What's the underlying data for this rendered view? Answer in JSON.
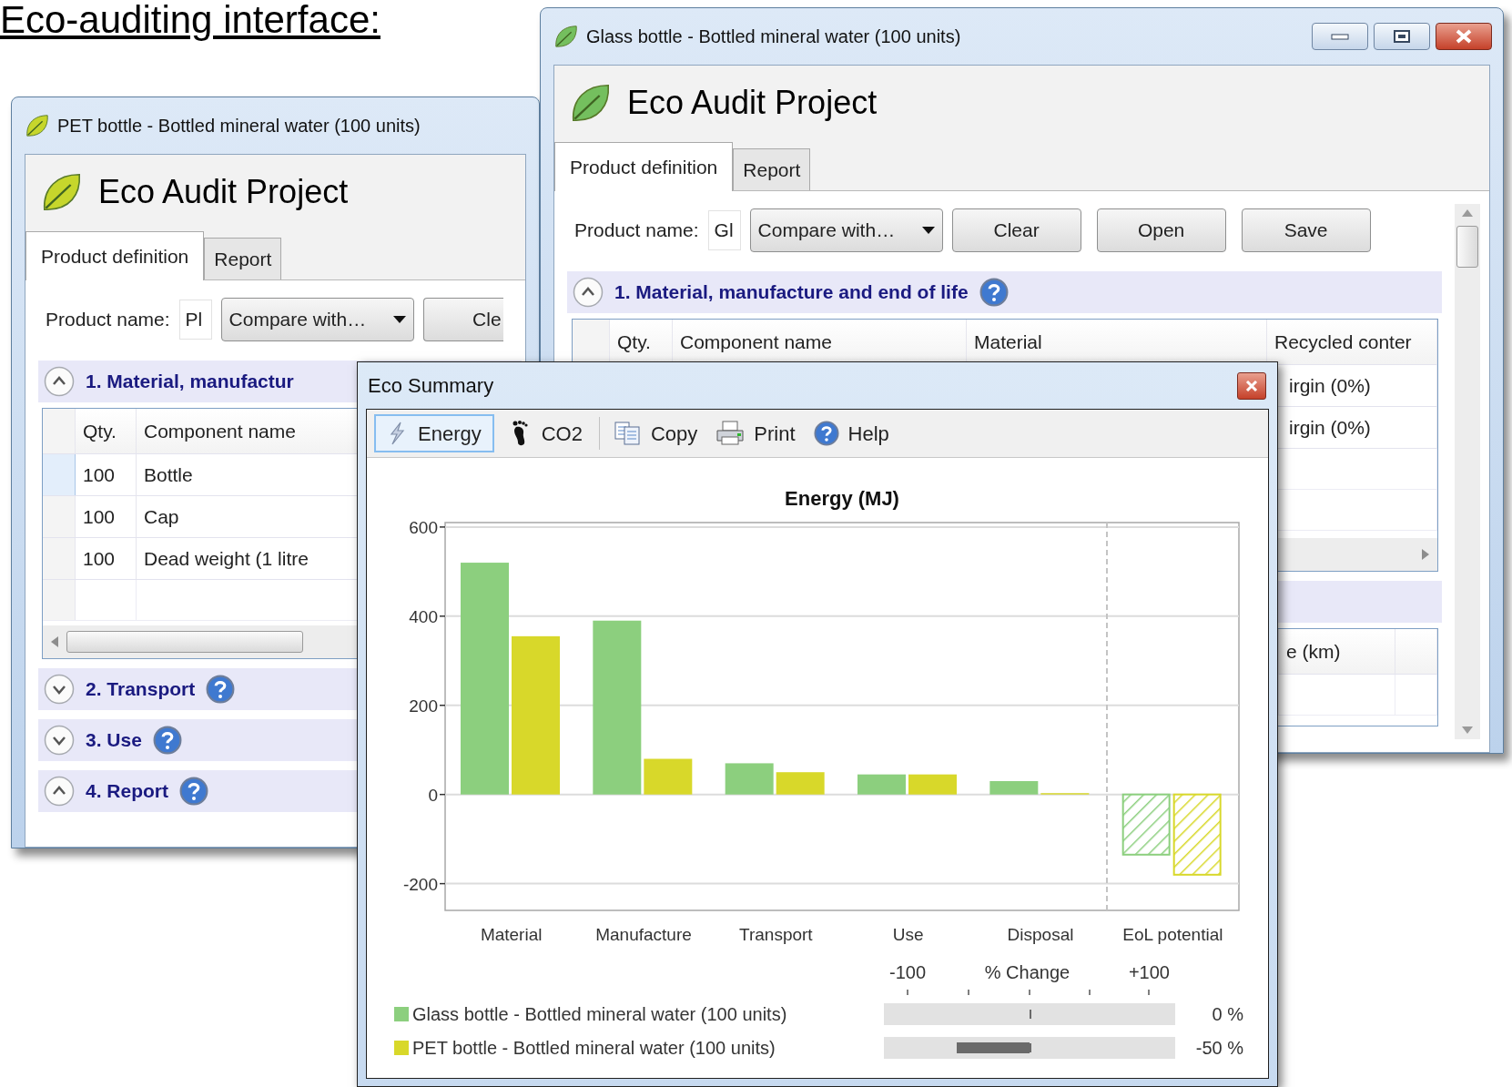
{
  "heading": "Eco-auditing interface:",
  "project_windows": [
    {
      "title": "PET bottle - Bottled mineral water (100 units)",
      "color": "#c6d62c",
      "window_controls": false,
      "app_title": "Eco Audit Project",
      "tabs": [
        {
          "label": "Product definition",
          "selected": true
        },
        {
          "label": "Report",
          "selected": false
        }
      ],
      "product_label": "Product name:",
      "product_value": "Pl",
      "compare": "Compare with…",
      "buttons": [
        "Cle"
      ],
      "sections": [
        {
          "title": "1. Material, manufactur",
          "expanded": true,
          "help": false,
          "table": {
            "columns": [
              "Qty.",
              "Component name"
            ],
            "rows": [
              {
                "cells": [
                  "100",
                  "Bottle"
                ],
                "selected": true
              },
              {
                "cells": [
                  "100",
                  "Cap"
                ],
                "selected": false
              },
              {
                "cells": [
                  "100",
                  "Dead weight (1 litre"
                ],
                "selected": false
              }
            ]
          }
        },
        {
          "title": "2. Transport",
          "expanded": false,
          "help": true
        },
        {
          "title": "3. Use",
          "expanded": false,
          "help": true
        },
        {
          "title": "4. Report",
          "expanded": true,
          "help": true
        }
      ]
    },
    {
      "title": "Glass bottle - Bottled mineral water (100 units)",
      "color": "#74bf5e",
      "window_controls": true,
      "app_title": "Eco Audit Project",
      "tabs": [
        {
          "label": "Product definition",
          "selected": true
        },
        {
          "label": "Report",
          "selected": false
        }
      ],
      "product_label": "Product name:",
      "product_value": "Gl",
      "compare": "Compare with…",
      "buttons": [
        "Clear",
        "Open",
        "Save"
      ],
      "sections": [
        {
          "title": "1. Material, manufacture and end of life",
          "expanded": true,
          "help": true,
          "table": {
            "columns": [
              "Qty.",
              "Component name",
              "Material",
              "Recycled conter"
            ],
            "rows": [
              {
                "cells": [
                  "irgin (0%)"
                ]
              },
              {
                "cells": [
                  "irgin (0%)"
                ]
              }
            ]
          }
        },
        {
          "table": {
            "columns": [
              "e (km)"
            ]
          }
        }
      ]
    }
  ],
  "eco_summary": {
    "title": "Eco Summary",
    "toolbar": {
      "toggles": [
        {
          "label": "Energy",
          "selected": true
        },
        {
          "label": "CO2",
          "selected": false
        }
      ],
      "actions": [
        "Copy",
        "Print",
        "Help"
      ]
    },
    "chart_data": {
      "type": "bar",
      "title": "Energy (MJ)",
      "categories": [
        "Material",
        "Manufacture",
        "Transport",
        "Use",
        "Disposal",
        "EoL potential"
      ],
      "series": [
        {
          "name": "Glass bottle - Bottled mineral water (100 units)",
          "color": "#8ccf7e",
          "values": [
            520,
            390,
            70,
            45,
            30,
            -135
          ]
        },
        {
          "name": "PET bottle - Bottled mineral water (100 units)",
          "color": "#d8d82a",
          "values": [
            355,
            80,
            50,
            45,
            3,
            -180
          ]
        }
      ],
      "ylim": [
        -260,
        610
      ],
      "grid": true,
      "yticks": [
        -200,
        0,
        200,
        400,
        600
      ]
    },
    "change_scale": {
      "min": "-100",
      "title": "% Change",
      "max": "+100"
    },
    "changes": [
      {
        "reading": "0 %"
      },
      {
        "reading": "-50 %"
      }
    ]
  }
}
